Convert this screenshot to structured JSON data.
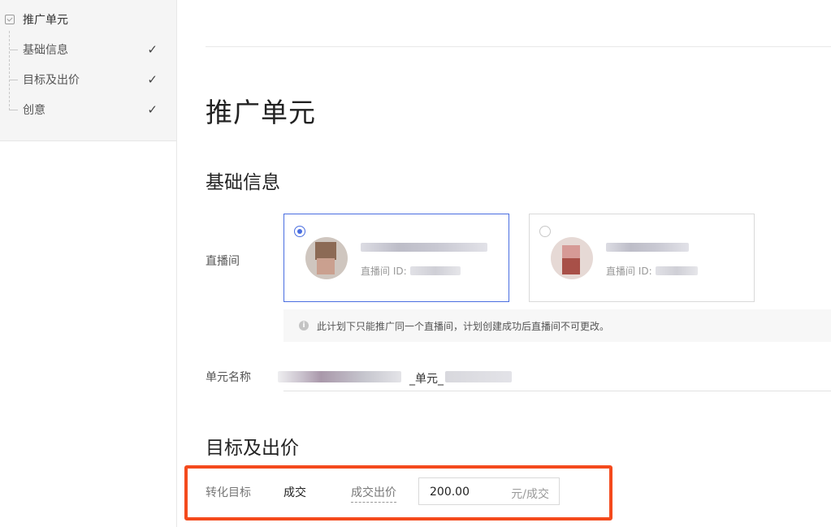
{
  "sidebar": {
    "root_label": "推广单元",
    "items": [
      {
        "label": "基础信息",
        "done": "✓"
      },
      {
        "label": "目标及出价",
        "done": "✓"
      },
      {
        "label": "创意",
        "done": "✓"
      }
    ]
  },
  "main": {
    "page_title": "推广单元",
    "basic_section": {
      "title": "基础信息",
      "live_room_label": "直播间",
      "rooms": [
        {
          "selected": true,
          "id_prefix": "直播间 ID:"
        },
        {
          "selected": false,
          "id_prefix": "直播间 ID:"
        }
      ],
      "notice": "此计划下只能推广同一个直播间，计划创建成功后直播间不可更改。",
      "unit_name_label": "单元名称",
      "unit_name_visible": "_单元_"
    },
    "target_section": {
      "title": "目标及出价",
      "conversion_label": "转化目标",
      "conversion_value": "成交",
      "bid_label": "成交出价",
      "bid_value": "200.00",
      "bid_unit": "元/成交"
    }
  },
  "colors": {
    "accent": "#4a6ee0",
    "highlight": "#f44a1d",
    "sidebar_bg": "#f5f5f5"
  }
}
